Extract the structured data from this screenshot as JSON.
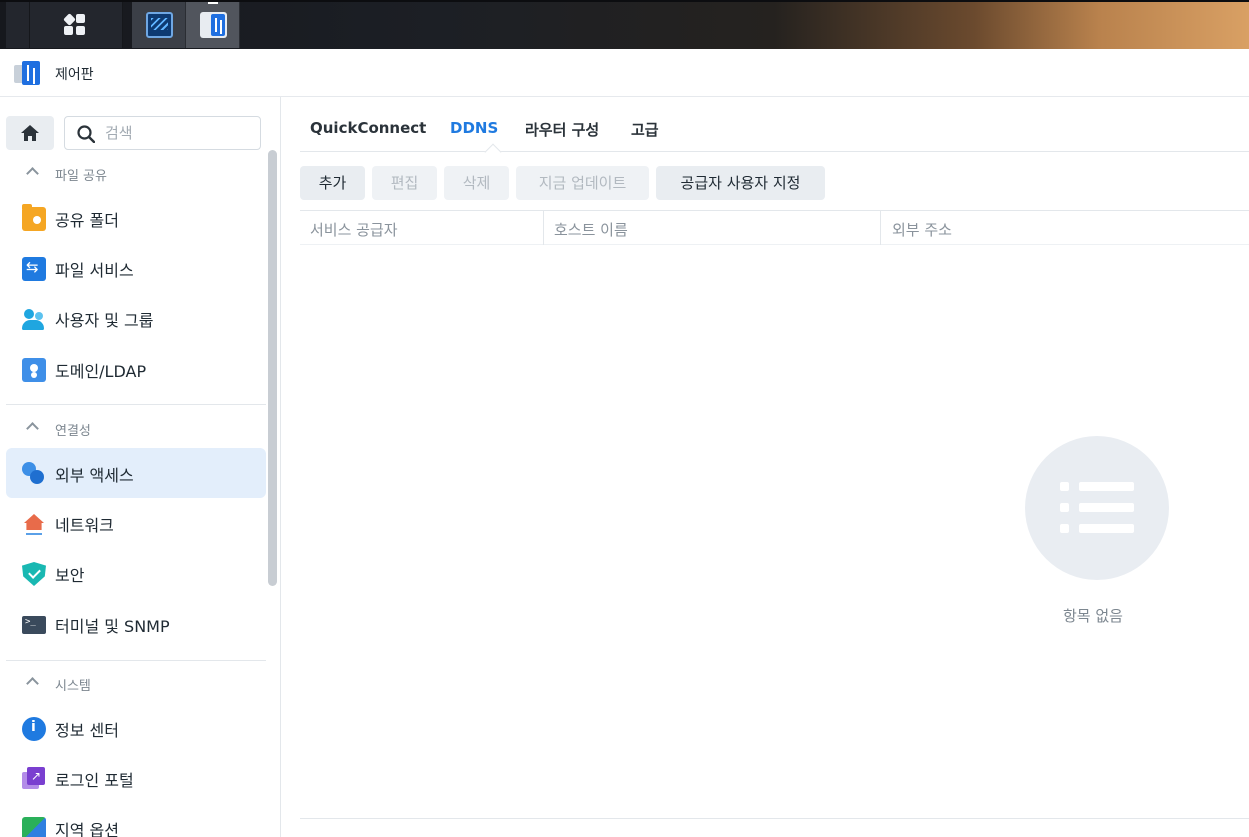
{
  "taskbar": {
    "main_menu_icon": "grid-icon",
    "apps": [
      {
        "name": "resource-monitor",
        "icon": "monitor-icon"
      },
      {
        "name": "control-panel",
        "icon": "control-panel-icon"
      }
    ]
  },
  "window": {
    "title": "제어판",
    "icon": "control-panel-icon"
  },
  "sidebar": {
    "search_placeholder": "검색",
    "groups": [
      {
        "label": "파일 공유",
        "items": [
          {
            "label": "공유 폴더",
            "icon": "shared-folder-icon"
          },
          {
            "label": "파일 서비스",
            "icon": "file-service-icon"
          },
          {
            "label": "사용자 및 그룹",
            "icon": "users-icon"
          },
          {
            "label": "도메인/LDAP",
            "icon": "domain-icon"
          }
        ]
      },
      {
        "label": "연결성",
        "items": [
          {
            "label": "외부 액세스",
            "icon": "external-access-icon",
            "selected": true
          },
          {
            "label": "네트워크",
            "icon": "network-icon"
          },
          {
            "label": "보안",
            "icon": "security-icon"
          },
          {
            "label": "터미널 및 SNMP",
            "icon": "terminal-icon"
          }
        ]
      },
      {
        "label": "시스템",
        "items": [
          {
            "label": "정보 센터",
            "icon": "info-center-icon"
          },
          {
            "label": "로그인 포털",
            "icon": "login-portal-icon"
          },
          {
            "label": "지역 옵션",
            "icon": "regional-options-icon"
          }
        ]
      }
    ]
  },
  "main": {
    "tabs": [
      {
        "label": "QuickConnect"
      },
      {
        "label": "DDNS",
        "active": true
      },
      {
        "label": "라우터 구성"
      },
      {
        "label": "고급"
      }
    ],
    "toolbar": {
      "add": "추가",
      "edit": "편집",
      "delete": "삭제",
      "update_now": "지금 업데이트",
      "customize_provider": "공급자 사용자 지정"
    },
    "columns": [
      "서비스 공급자",
      "호스트 이름",
      "외부 주소"
    ],
    "rows": [],
    "empty_text": "항목 없음"
  },
  "colors": {
    "accent": "#1f7ae0",
    "selected_bg": "#e3eefb"
  }
}
